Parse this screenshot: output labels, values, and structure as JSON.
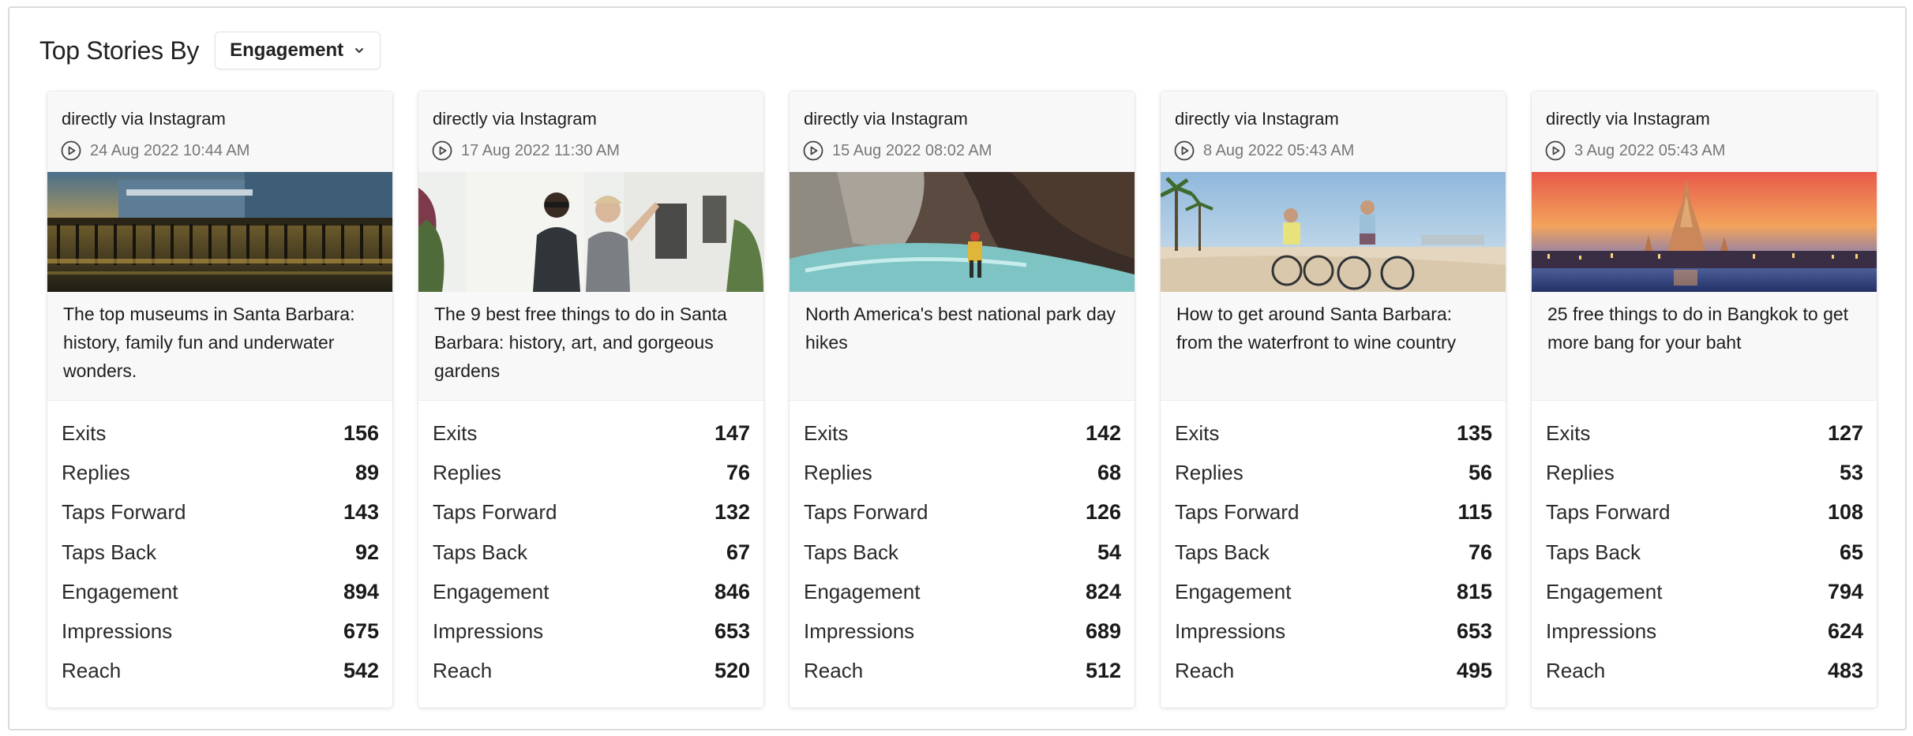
{
  "header": {
    "title": "Top Stories By",
    "sort_selected": "Engagement"
  },
  "metric_labels": {
    "exits": "Exits",
    "replies": "Replies",
    "taps_forward": "Taps Forward",
    "taps_back": "Taps Back",
    "engagement": "Engagement",
    "impressions": "Impressions",
    "reach": "Reach"
  },
  "stories": [
    {
      "source": "directly via Instagram",
      "date": "24 Aug 2022 10:44 AM",
      "caption": "The top museums in Santa Barbara: history, family fun and underwater wonders.",
      "image": "pier-sunset",
      "metrics": {
        "exits": "156",
        "replies": "89",
        "taps_forward": "143",
        "taps_back": "92",
        "engagement": "894",
        "impressions": "675",
        "reach": "542"
      }
    },
    {
      "source": "directly via Instagram",
      "date": "17 Aug 2022 11:30 AM",
      "caption": "The 9 best free things to do in Santa Barbara: history, art, and gorgeous gardens",
      "image": "tourists-street",
      "metrics": {
        "exits": "147",
        "replies": "76",
        "taps_forward": "132",
        "taps_back": "67",
        "engagement": "846",
        "impressions": "653",
        "reach": "520"
      }
    },
    {
      "source": "directly via Instagram",
      "date": "15 Aug 2022 08:02 AM",
      "caption": "North America's best national park day hikes",
      "image": "canyon-hike",
      "metrics": {
        "exits": "142",
        "replies": "68",
        "taps_forward": "126",
        "taps_back": "54",
        "engagement": "824",
        "impressions": "689",
        "reach": "512"
      }
    },
    {
      "source": "directly via Instagram",
      "date": "8 Aug 2022 05:43 AM",
      "caption": "How to get around Santa Barbara: from the waterfront to wine country",
      "image": "beach-bikes",
      "metrics": {
        "exits": "135",
        "replies": "56",
        "taps_forward": "115",
        "taps_back": "76",
        "engagement": "815",
        "impressions": "653",
        "reach": "495"
      }
    },
    {
      "source": "directly via Instagram",
      "date": "3 Aug 2022 05:43 AM",
      "caption": "25 free things to do in Bangkok to get more bang for your baht",
      "image": "temple-dusk",
      "metrics": {
        "exits": "127",
        "replies": "53",
        "taps_forward": "108",
        "taps_back": "65",
        "engagement": "794",
        "impressions": "624",
        "reach": "483"
      }
    }
  ]
}
